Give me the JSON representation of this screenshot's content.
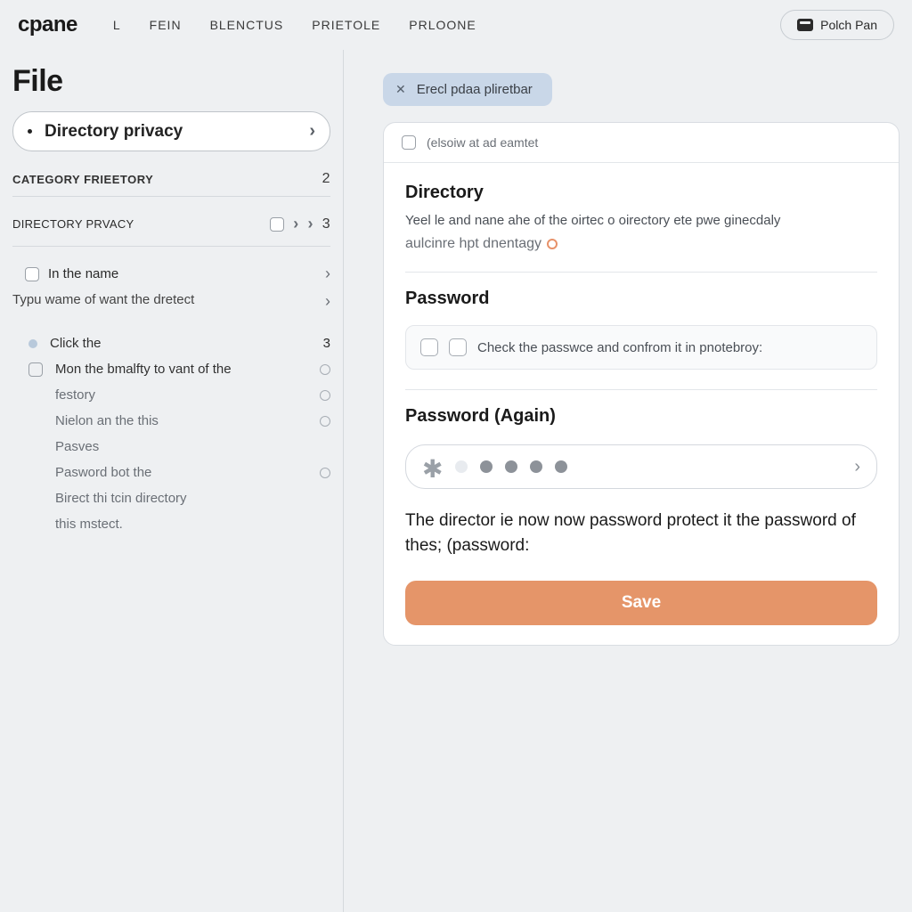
{
  "header": {
    "logo": "cpane",
    "nav": [
      "L",
      "FEIN",
      "BLENCTUS",
      "PRIETOLE",
      "PRLOONE"
    ],
    "user": "Polch Pan"
  },
  "sidebar": {
    "page_title": "File",
    "selector_label": "Directory privacy",
    "section1": {
      "title": "CATEGORY FRIEETORY",
      "count": "2"
    },
    "row_a": {
      "label": "DIRECTORY PRVACY",
      "count": "3"
    },
    "row_b": {
      "label": "In the name"
    },
    "text_line": "Typu wame of want the dretect",
    "click_row": {
      "label": "Click the",
      "count": "3"
    },
    "items": [
      "Mon the bmalfty to vant of the",
      "festory",
      "Nielon an the this",
      "Pasves",
      "Pasword bot the",
      "Birect thi tcin directory",
      "this mstect."
    ]
  },
  "content": {
    "chip": "Erecl pdaa pliretbar",
    "card_top": "(elsoiw at ad eamtet",
    "dir_label": "Directory",
    "dir_desc": "Yeel le and nane ahe of the oirtec o oirectory ete pwe ginecdaly",
    "dir_link": "aulcinre hpt dnentagy",
    "pwd_label": "Password",
    "pwd_check_text": "Check the passwce and confrom it in pnotebroy:",
    "pwd_again_label": "Password  (Again)",
    "result_text": "The director ie now now password protect it the password of thes; (password:",
    "save": "Save"
  }
}
